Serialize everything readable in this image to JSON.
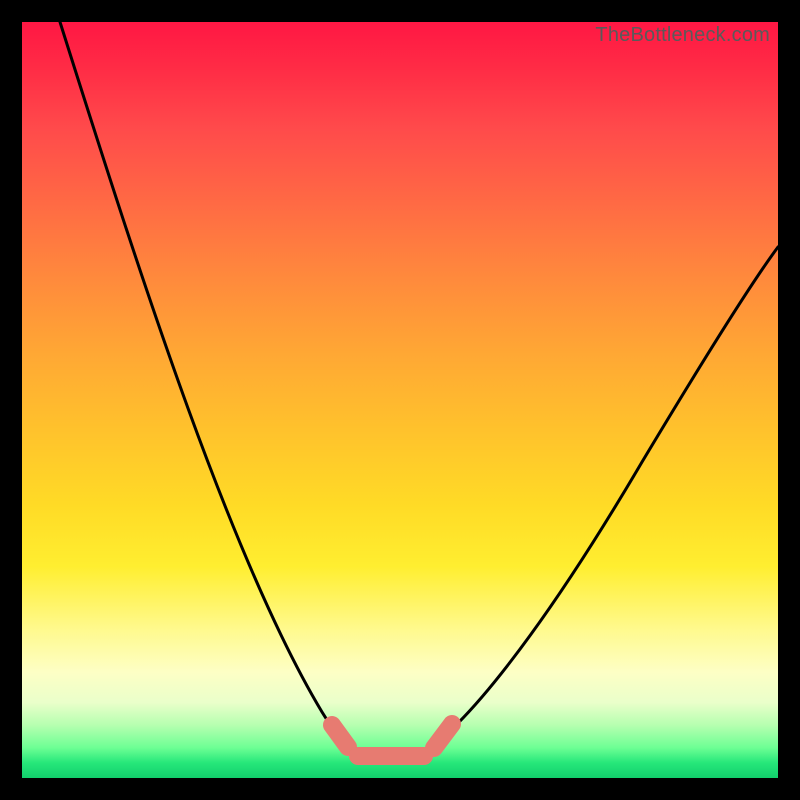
{
  "watermark": "TheBottleneck.com",
  "chart_data": {
    "type": "line",
    "title": "",
    "xlabel": "",
    "ylabel": "",
    "xlim": [
      0,
      100
    ],
    "ylim": [
      0,
      100
    ],
    "series": [
      {
        "name": "bottleneck-curve",
        "x": [
          5,
          10,
          15,
          20,
          25,
          30,
          35,
          40,
          43,
          46,
          49,
          52,
          55,
          60,
          65,
          70,
          75,
          80,
          85,
          90,
          95,
          100
        ],
        "values": [
          100,
          89,
          78,
          67,
          56,
          45,
          34,
          22,
          12,
          5,
          2,
          2,
          4,
          9,
          17,
          25,
          33,
          41,
          49,
          56,
          63,
          70
        ]
      }
    ],
    "markers": {
      "name": "optimal-range",
      "x": [
        42.5,
        45,
        47,
        49,
        51,
        53,
        55,
        57
      ],
      "values": [
        13.5,
        5.5,
        3,
        2,
        2,
        2.5,
        4,
        7
      ],
      "color": "#e77b71"
    },
    "gradient_stops": [
      {
        "pos": 0,
        "color": "#ff1744"
      },
      {
        "pos": 50,
        "color": "#ffc22c"
      },
      {
        "pos": 80,
        "color": "#fff98a"
      },
      {
        "pos": 100,
        "color": "#12cf6c"
      }
    ]
  }
}
